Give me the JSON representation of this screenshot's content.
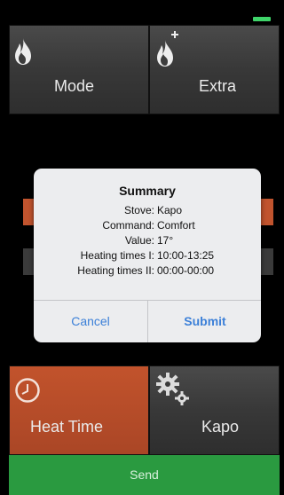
{
  "tiles": {
    "mode": "Mode",
    "extra": "Extra",
    "heat_time": "Heat Time",
    "stove": "Kapo"
  },
  "send": "Send",
  "dialog": {
    "title": "Summary",
    "rows": [
      {
        "key": "Stove:",
        "value": "Kapo"
      },
      {
        "key": "Command:",
        "value": "Comfort"
      },
      {
        "key": "Value:",
        "value": "17°"
      },
      {
        "key": "Heating times I:",
        "value": "10:00-13:25"
      },
      {
        "key": "Heating times II:",
        "value": "00:00-00:00"
      }
    ],
    "cancel": "Cancel",
    "submit": "Submit"
  },
  "icons": {
    "mode": "flame-icon",
    "extra": "flame-plus-icon",
    "heat_time": "clock-icon",
    "stove": "gears-icon"
  },
  "colors": {
    "accent_orange": "#c2532c",
    "send_green": "#2a9a40",
    "battery_green": "#3fd46a",
    "dialog_button_blue": "#3c80d8"
  }
}
